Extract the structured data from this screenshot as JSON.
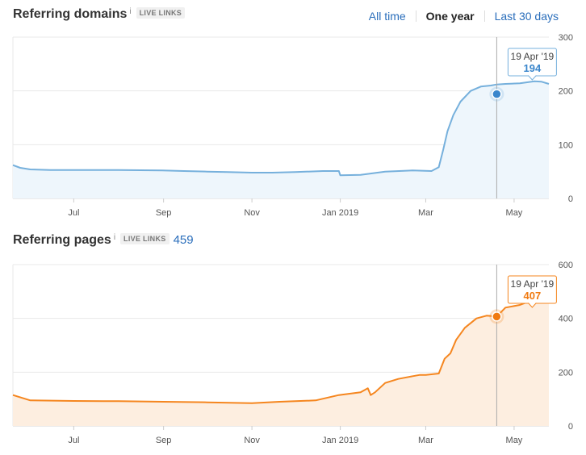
{
  "header": {
    "tabs": [
      {
        "label": "All time",
        "active": false
      },
      {
        "label": "One year",
        "active": true
      },
      {
        "label": "Last 30 days",
        "active": false
      }
    ]
  },
  "domains_section": {
    "title": "Referring domains",
    "info": "i",
    "badge": "LIVE LINKS"
  },
  "pages_section": {
    "title": "Referring pages",
    "info": "i",
    "badge": "LIVE LINKS",
    "total": "459"
  },
  "colors": {
    "domains_line": "#76b0dc",
    "domains_fill": "#eef6fc",
    "domains_accent": "#3a86cc",
    "pages_line": "#f5861f",
    "pages_fill": "#fdeee0",
    "pages_accent": "#f07a10"
  },
  "chart_data": [
    {
      "type": "area",
      "x_tick_labels": [
        "Jul",
        "Sep",
        "Nov",
        "Jan 2019",
        "Mar",
        "May"
      ],
      "x_tick_dates": [
        "2018-07-01",
        "2018-09-01",
        "2018-11-01",
        "2019-01-01",
        "2019-03-01",
        "2019-05-01"
      ],
      "x_range": [
        "2018-05-20",
        "2019-05-25"
      ],
      "ylim": [
        0,
        300
      ],
      "y_ticks": [
        0,
        100,
        200,
        300
      ],
      "grid": true,
      "series": [
        {
          "x": [
            "2018-05-20",
            "2018-05-25",
            "2018-06-01",
            "2018-06-15",
            "2018-07-01",
            "2018-08-01",
            "2018-08-31",
            "2018-09-15",
            "2018-10-01",
            "2018-10-15",
            "2018-11-01",
            "2018-11-15",
            "2018-12-01",
            "2018-12-20",
            "2018-12-31",
            "2019-01-01",
            "2019-01-15",
            "2019-02-01",
            "2019-02-20",
            "2019-03-05",
            "2019-03-10",
            "2019-03-13",
            "2019-03-16",
            "2019-03-20",
            "2019-03-25",
            "2019-04-01",
            "2019-04-08",
            "2019-04-15",
            "2019-04-19",
            "2019-04-25",
            "2019-05-05",
            "2019-05-15",
            "2019-05-20",
            "2019-05-25"
          ],
          "values": [
            62,
            57,
            54,
            53,
            53,
            53,
            52,
            51,
            50,
            49,
            48,
            48,
            49,
            51,
            51,
            43,
            44,
            50,
            52,
            51,
            58,
            90,
            125,
            155,
            180,
            200,
            208,
            210,
            212,
            213,
            214,
            218,
            217,
            213
          ]
        }
      ],
      "tooltip": {
        "date": "19 Apr '19",
        "value": "194",
        "x": "2019-04-19",
        "y": 194
      }
    },
    {
      "type": "area",
      "total": 459,
      "x_tick_labels": [
        "Jul",
        "Sep",
        "Nov",
        "Jan 2019",
        "Mar",
        "May"
      ],
      "x_tick_dates": [
        "2018-07-01",
        "2018-09-01",
        "2018-11-01",
        "2019-01-01",
        "2019-03-01",
        "2019-05-01"
      ],
      "x_range": [
        "2018-05-20",
        "2019-05-25"
      ],
      "ylim": [
        0,
        600
      ],
      "y_ticks": [
        0,
        200,
        400,
        600
      ],
      "grid": true,
      "series": [
        {
          "x": [
            "2018-05-20",
            "2018-06-01",
            "2018-07-01",
            "2018-08-01",
            "2018-09-01",
            "2018-10-01",
            "2018-11-01",
            "2018-11-20",
            "2018-12-01",
            "2018-12-15",
            "2018-12-31",
            "2019-01-15",
            "2019-01-20",
            "2019-01-22",
            "2019-01-25",
            "2019-02-01",
            "2019-02-10",
            "2019-02-20",
            "2019-02-25",
            "2019-03-01",
            "2019-03-10",
            "2019-03-14",
            "2019-03-18",
            "2019-03-22",
            "2019-03-28",
            "2019-04-05",
            "2019-04-12",
            "2019-04-19",
            "2019-04-25",
            "2019-05-05",
            "2019-05-15",
            "2019-05-25"
          ],
          "values": [
            115,
            95,
            93,
            92,
            90,
            88,
            85,
            90,
            92,
            95,
            115,
            125,
            140,
            115,
            125,
            160,
            175,
            185,
            190,
            190,
            195,
            250,
            270,
            320,
            365,
            400,
            410,
            407,
            440,
            450,
            470,
            485
          ]
        }
      ],
      "tooltip": {
        "date": "19 Apr '19",
        "value": "407",
        "x": "2019-04-19",
        "y": 407
      }
    }
  ]
}
